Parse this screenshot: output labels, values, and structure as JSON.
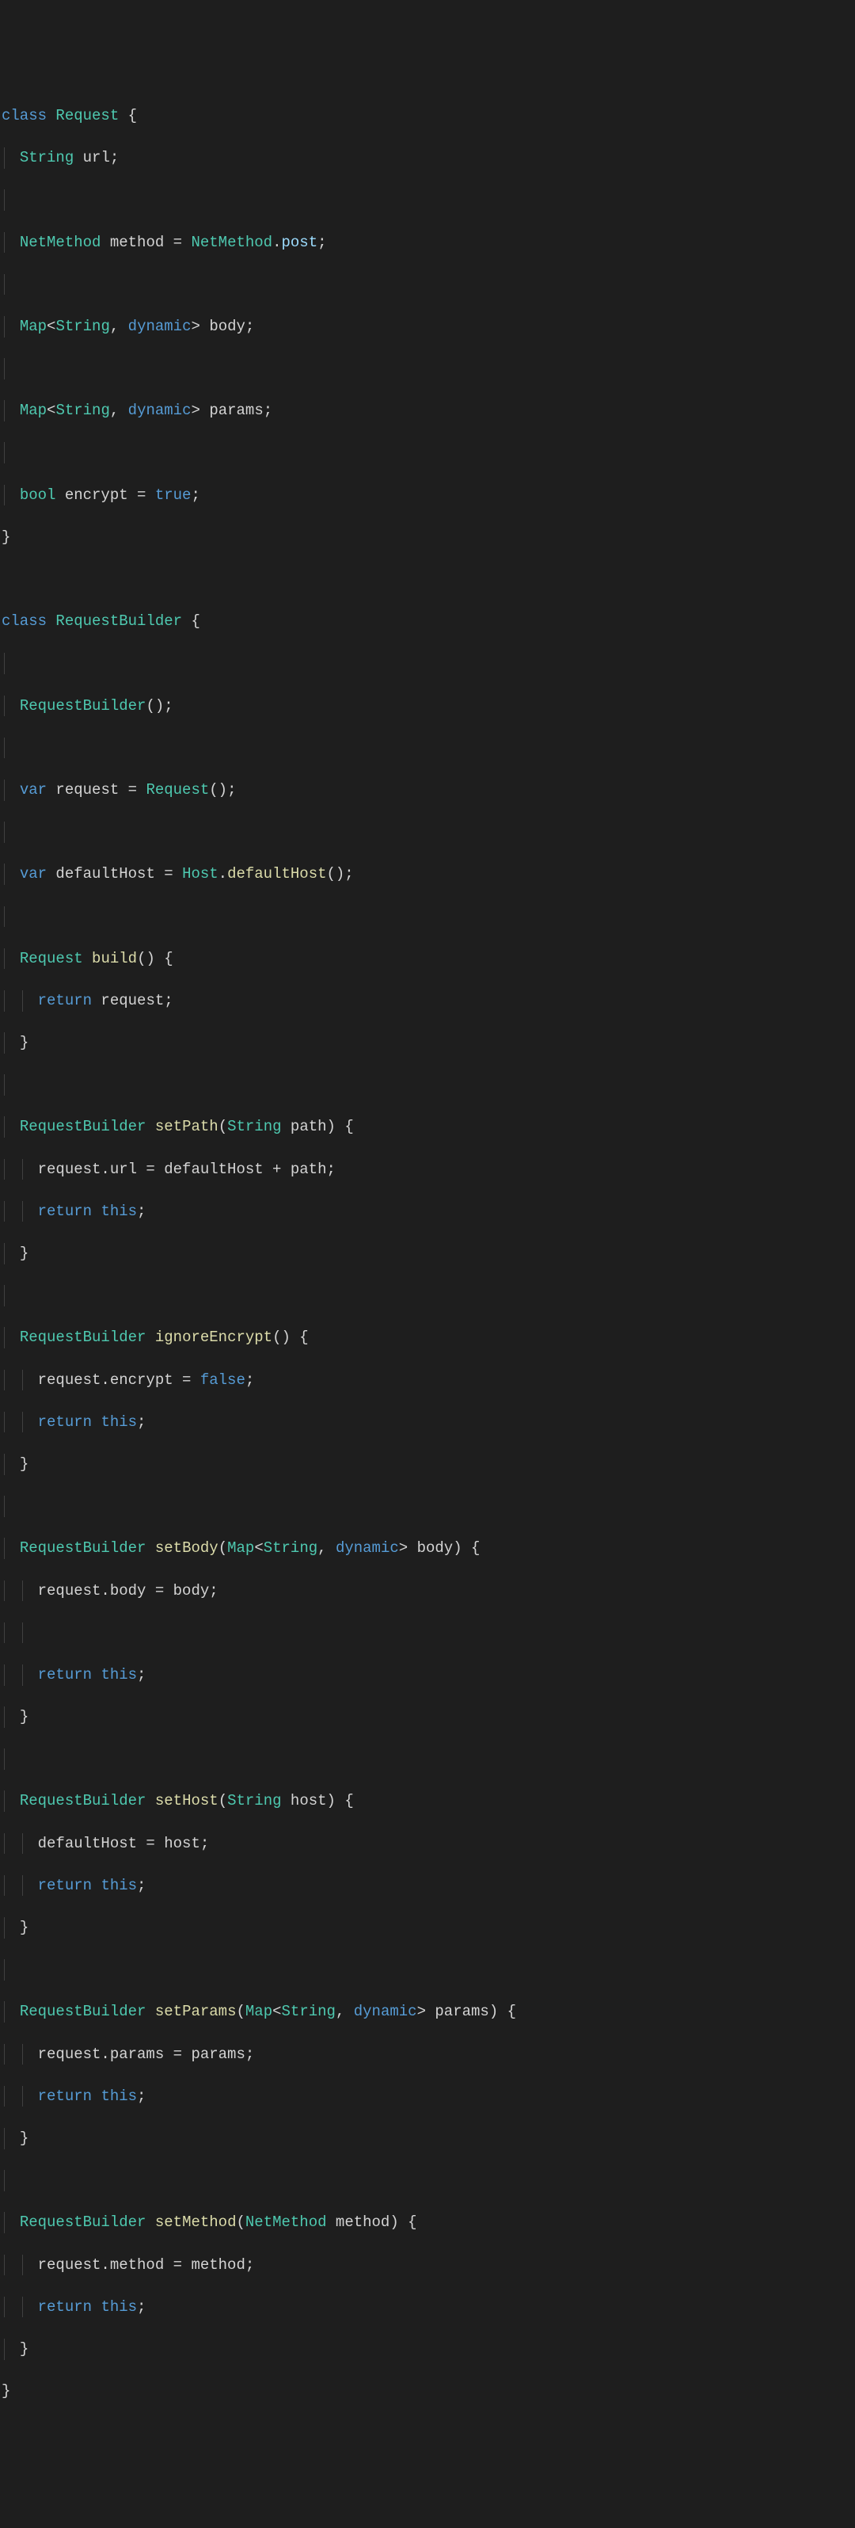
{
  "code": {
    "lines": [
      [
        [
          "kw",
          "class "
        ],
        [
          "type",
          "Request"
        ],
        [
          "punc",
          " {"
        ]
      ],
      [
        [
          "id",
          "  "
        ],
        [
          "type",
          "String"
        ],
        [
          "id",
          " url;"
        ]
      ],
      [
        [
          "id",
          ""
        ]
      ],
      [
        [
          "id",
          "  "
        ],
        [
          "type",
          "NetMethod"
        ],
        [
          "id",
          " method = "
        ],
        [
          "type",
          "NetMethod"
        ],
        [
          "punc",
          "."
        ],
        [
          "prop",
          "post"
        ],
        [
          "punc",
          ";"
        ]
      ],
      [
        [
          "id",
          ""
        ]
      ],
      [
        [
          "id",
          "  "
        ],
        [
          "type",
          "Map"
        ],
        [
          "punc",
          "<"
        ],
        [
          "type",
          "String"
        ],
        [
          "punc",
          ", "
        ],
        [
          "kw",
          "dynamic"
        ],
        [
          "punc",
          "> "
        ],
        [
          "id",
          "body;"
        ]
      ],
      [
        [
          "id",
          ""
        ]
      ],
      [
        [
          "id",
          "  "
        ],
        [
          "type",
          "Map"
        ],
        [
          "punc",
          "<"
        ],
        [
          "type",
          "String"
        ],
        [
          "punc",
          ", "
        ],
        [
          "kw",
          "dynamic"
        ],
        [
          "punc",
          "> "
        ],
        [
          "id",
          "params;"
        ]
      ],
      [
        [
          "id",
          ""
        ]
      ],
      [
        [
          "id",
          "  "
        ],
        [
          "type",
          "bool"
        ],
        [
          "id",
          " encrypt = "
        ],
        [
          "bool",
          "true"
        ],
        [
          "punc",
          ";"
        ]
      ],
      [
        [
          "punc",
          "}"
        ]
      ],
      [
        [
          "id",
          ""
        ]
      ],
      [
        [
          "kw",
          "class "
        ],
        [
          "type",
          "RequestBuilder"
        ],
        [
          "punc",
          " {"
        ]
      ],
      [
        [
          "id",
          ""
        ]
      ],
      [
        [
          "id",
          "  "
        ],
        [
          "type",
          "RequestBuilder"
        ],
        [
          "punc",
          "();"
        ]
      ],
      [
        [
          "id",
          ""
        ]
      ],
      [
        [
          "id",
          "  "
        ],
        [
          "kw",
          "var"
        ],
        [
          "id",
          " request = "
        ],
        [
          "type",
          "Request"
        ],
        [
          "punc",
          "();"
        ]
      ],
      [
        [
          "id",
          ""
        ]
      ],
      [
        [
          "id",
          "  "
        ],
        [
          "kw",
          "var"
        ],
        [
          "id",
          " defaultHost = "
        ],
        [
          "type",
          "Host"
        ],
        [
          "punc",
          "."
        ],
        [
          "fn",
          "defaultHost"
        ],
        [
          "punc",
          "();"
        ]
      ],
      [
        [
          "id",
          ""
        ]
      ],
      [
        [
          "id",
          "  "
        ],
        [
          "type",
          "Request"
        ],
        [
          "id",
          " "
        ],
        [
          "fn",
          "build"
        ],
        [
          "punc",
          "() {"
        ]
      ],
      [
        [
          "id",
          "    "
        ],
        [
          "kw",
          "return"
        ],
        [
          "id",
          " request;"
        ]
      ],
      [
        [
          "id",
          "  "
        ],
        [
          "punc",
          "}"
        ]
      ],
      [
        [
          "id",
          ""
        ]
      ],
      [
        [
          "id",
          "  "
        ],
        [
          "type",
          "RequestBuilder"
        ],
        [
          "id",
          " "
        ],
        [
          "fn",
          "setPath"
        ],
        [
          "punc",
          "("
        ],
        [
          "type",
          "String"
        ],
        [
          "id",
          " path"
        ],
        [
          "punc",
          ") {"
        ]
      ],
      [
        [
          "id",
          "    request.url = defaultHost + path;"
        ]
      ],
      [
        [
          "id",
          "    "
        ],
        [
          "kw",
          "return"
        ],
        [
          "id",
          " "
        ],
        [
          "this",
          "this"
        ],
        [
          "punc",
          ";"
        ]
      ],
      [
        [
          "id",
          "  "
        ],
        [
          "punc",
          "}"
        ]
      ],
      [
        [
          "id",
          ""
        ]
      ],
      [
        [
          "id",
          "  "
        ],
        [
          "type",
          "RequestBuilder"
        ],
        [
          "id",
          " "
        ],
        [
          "fn",
          "ignoreEncrypt"
        ],
        [
          "punc",
          "() {"
        ]
      ],
      [
        [
          "id",
          "    request.encrypt = "
        ],
        [
          "bool",
          "false"
        ],
        [
          "punc",
          ";"
        ]
      ],
      [
        [
          "id",
          "    "
        ],
        [
          "kw",
          "return"
        ],
        [
          "id",
          " "
        ],
        [
          "this",
          "this"
        ],
        [
          "punc",
          ";"
        ]
      ],
      [
        [
          "id",
          "  "
        ],
        [
          "punc",
          "}"
        ]
      ],
      [
        [
          "id",
          ""
        ]
      ],
      [
        [
          "id",
          "  "
        ],
        [
          "type",
          "RequestBuilder"
        ],
        [
          "id",
          " "
        ],
        [
          "fn",
          "setBody"
        ],
        [
          "punc",
          "("
        ],
        [
          "type",
          "Map"
        ],
        [
          "punc",
          "<"
        ],
        [
          "type",
          "String"
        ],
        [
          "punc",
          ", "
        ],
        [
          "kw",
          "dynamic"
        ],
        [
          "punc",
          "> "
        ],
        [
          "id",
          "body"
        ],
        [
          "punc",
          ") {"
        ]
      ],
      [
        [
          "id",
          "    request.body = body;"
        ]
      ],
      [
        [
          "id",
          ""
        ]
      ],
      [
        [
          "id",
          "    "
        ],
        [
          "kw",
          "return"
        ],
        [
          "id",
          " "
        ],
        [
          "this",
          "this"
        ],
        [
          "punc",
          ";"
        ]
      ],
      [
        [
          "id",
          "  "
        ],
        [
          "punc",
          "}"
        ]
      ],
      [
        [
          "id",
          ""
        ]
      ],
      [
        [
          "id",
          "  "
        ],
        [
          "type",
          "RequestBuilder"
        ],
        [
          "id",
          " "
        ],
        [
          "fn",
          "setHost"
        ],
        [
          "punc",
          "("
        ],
        [
          "type",
          "String"
        ],
        [
          "id",
          " host"
        ],
        [
          "punc",
          ") {"
        ]
      ],
      [
        [
          "id",
          "    defaultHost = host;"
        ]
      ],
      [
        [
          "id",
          "    "
        ],
        [
          "kw",
          "return"
        ],
        [
          "id",
          " "
        ],
        [
          "this",
          "this"
        ],
        [
          "punc",
          ";"
        ]
      ],
      [
        [
          "id",
          "  "
        ],
        [
          "punc",
          "}"
        ]
      ],
      [
        [
          "id",
          ""
        ]
      ],
      [
        [
          "id",
          "  "
        ],
        [
          "type",
          "RequestBuilder"
        ],
        [
          "id",
          " "
        ],
        [
          "fn",
          "setParams"
        ],
        [
          "punc",
          "("
        ],
        [
          "type",
          "Map"
        ],
        [
          "punc",
          "<"
        ],
        [
          "type",
          "String"
        ],
        [
          "punc",
          ", "
        ],
        [
          "kw",
          "dynamic"
        ],
        [
          "punc",
          "> "
        ],
        [
          "id",
          "params"
        ],
        [
          "punc",
          ") {"
        ]
      ],
      [
        [
          "id",
          "    request.params = params;"
        ]
      ],
      [
        [
          "id",
          "    "
        ],
        [
          "kw",
          "return"
        ],
        [
          "id",
          " "
        ],
        [
          "this",
          "this"
        ],
        [
          "punc",
          ";"
        ]
      ],
      [
        [
          "id",
          "  "
        ],
        [
          "punc",
          "}"
        ]
      ],
      [
        [
          "id",
          ""
        ]
      ],
      [
        [
          "id",
          "  "
        ],
        [
          "type",
          "RequestBuilder"
        ],
        [
          "id",
          " "
        ],
        [
          "fn",
          "setMethod"
        ],
        [
          "punc",
          "("
        ],
        [
          "type",
          "NetMethod"
        ],
        [
          "id",
          " method"
        ],
        [
          "punc",
          ") {"
        ]
      ],
      [
        [
          "id",
          "    request.method = method;"
        ]
      ],
      [
        [
          "id",
          "    "
        ],
        [
          "kw",
          "return"
        ],
        [
          "id",
          " "
        ],
        [
          "this",
          "this"
        ],
        [
          "punc",
          ";"
        ]
      ],
      [
        [
          "id",
          "  "
        ],
        [
          "punc",
          "}"
        ]
      ],
      [
        [
          "punc",
          "}"
        ]
      ]
    ],
    "guide_levels": [
      [],
      [
        0
      ],
      [
        0
      ],
      [
        0
      ],
      [
        0
      ],
      [
        0
      ],
      [
        0
      ],
      [
        0
      ],
      [
        0
      ],
      [
        0
      ],
      [],
      [],
      [],
      [
        0
      ],
      [
        0
      ],
      [
        0
      ],
      [
        0
      ],
      [
        0
      ],
      [
        0
      ],
      [
        0
      ],
      [
        0
      ],
      [
        0,
        1
      ],
      [
        0
      ],
      [
        0
      ],
      [
        0
      ],
      [
        0,
        1
      ],
      [
        0,
        1
      ],
      [
        0
      ],
      [
        0
      ],
      [
        0
      ],
      [
        0,
        1
      ],
      [
        0,
        1
      ],
      [
        0
      ],
      [
        0
      ],
      [
        0
      ],
      [
        0,
        1
      ],
      [
        0,
        1
      ],
      [
        0,
        1
      ],
      [
        0
      ],
      [
        0
      ],
      [
        0
      ],
      [
        0,
        1
      ],
      [
        0,
        1
      ],
      [
        0
      ],
      [
        0
      ],
      [
        0
      ],
      [
        0,
        1
      ],
      [
        0,
        1
      ],
      [
        0
      ],
      [
        0
      ],
      [
        0
      ],
      [
        0,
        1
      ],
      [
        0,
        1
      ],
      [
        0
      ],
      []
    ]
  }
}
